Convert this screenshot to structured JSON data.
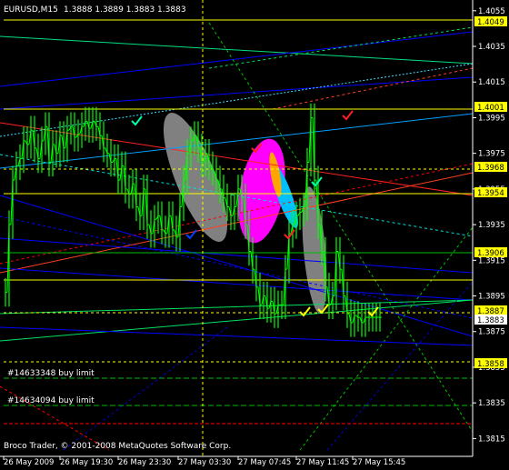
{
  "header": {
    "symbol": "EURUSD,M15",
    "quote": "1.3888 1.3889 1.3883 1.3883"
  },
  "orders": [
    {
      "label": "#14633348 buy limit",
      "price": 1.3845
    },
    {
      "label": "#14634094 buy limit",
      "price": 1.3835
    }
  ],
  "copyright": "Broco Trader, © 2001-2008 MetaQuotes Software Corp.",
  "colors": {
    "background": "#000000",
    "axis": "#ffffff",
    "price_line": "#00ff00",
    "ellipse_gray": "#808080",
    "ellipse_magenta": "#ff00ff",
    "ellipse_cyan": "#00bfff",
    "ellipse_orange": "#ffa500",
    "hline_yellow": "#ffff00",
    "hline_green": "#00c000",
    "hline_red": "#ff0000",
    "trend_blue": "#0000ff",
    "trend_red": "#ff0000",
    "trend_green": "#00ff7f",
    "highlight_box": "#ffff00"
  },
  "chart_data": {
    "type": "line",
    "ylim": [
      1.3805,
      1.406
    ],
    "x_tick_labels": [
      "26 May 2009",
      "26 May 19:30",
      "26 May 23:30",
      "27 May 03:30",
      "27 May 07:45",
      "27 May 11:45",
      "27 May 15:45"
    ],
    "y_tick_labels": [
      "1.4055",
      "1.4035",
      "1.4015",
      "1.3995",
      "1.3975",
      "1.3955",
      "1.3935",
      "1.3915",
      "1.3895",
      "1.3875",
      "1.3855",
      "1.3835",
      "1.3815"
    ],
    "highlighted_levels": [
      "1.4049",
      "1.4001",
      "1.3968",
      "1.3954",
      "1.3906",
      "1.3887",
      "1.3883",
      "1.3858"
    ],
    "series": [
      {
        "x": [
          0,
          4,
          8,
          12,
          16,
          20,
          24,
          28,
          32,
          36,
          40,
          44,
          48,
          52,
          56,
          60,
          64,
          68,
          72,
          76,
          80,
          84,
          88,
          92,
          96,
          100,
          104,
          108,
          112,
          116,
          120,
          124,
          128,
          132,
          136,
          140,
          144,
          148,
          152,
          156,
          160,
          164,
          168,
          172,
          176,
          180,
          184,
          188,
          192,
          196,
          200,
          204,
          208,
          212,
          216,
          220,
          224,
          228,
          232,
          236,
          240,
          244,
          248,
          252,
          256,
          260,
          264,
          268,
          272,
          276,
          280,
          284,
          288,
          292,
          296,
          300,
          304,
          308,
          312,
          316,
          320,
          324,
          328,
          332,
          336,
          340,
          344,
          348,
          352,
          356,
          360,
          364,
          368,
          372,
          376,
          380,
          384,
          388,
          392,
          396,
          400,
          404,
          408,
          412
        ],
        "y": [
          1.3897,
          1.3935,
          1.396,
          1.3968,
          1.3972,
          1.3982,
          1.398,
          1.3988,
          1.3978,
          1.3972,
          1.3982,
          1.399,
          1.397,
          1.398,
          1.3975,
          1.3985,
          1.3978,
          1.3988,
          1.399,
          1.3984,
          1.3986,
          1.399,
          1.3993,
          1.3989,
          1.3993,
          1.399,
          1.3985,
          1.3978,
          1.3975,
          1.397,
          1.3972,
          1.396,
          1.3968,
          1.3955,
          1.3952,
          1.3958,
          1.3945,
          1.394,
          1.3955,
          1.3935,
          1.393,
          1.3938,
          1.394,
          1.3932,
          1.393,
          1.394,
          1.3932,
          1.3928,
          1.3945,
          1.396,
          1.3975,
          1.3982,
          1.3985,
          1.3978,
          1.397,
          1.3975,
          1.3968,
          1.3965,
          1.396,
          1.3955,
          1.395,
          1.3945,
          1.394,
          1.3945,
          1.3955,
          1.395,
          1.3935,
          1.392,
          1.391,
          1.39,
          1.389,
          1.3895,
          1.3888,
          1.3892,
          1.3885,
          1.389,
          1.389,
          1.391,
          1.393,
          1.3935,
          1.394,
          1.3942,
          1.3945,
          1.397,
          1.3995,
          1.396,
          1.3935,
          1.392,
          1.39,
          1.389,
          1.3895,
          1.392,
          1.391,
          1.3895,
          1.3885,
          1.388,
          1.3884,
          1.3883,
          1.388,
          1.3883,
          1.3883,
          1.3883,
          1.3883,
          1.3883
        ]
      }
    ]
  }
}
